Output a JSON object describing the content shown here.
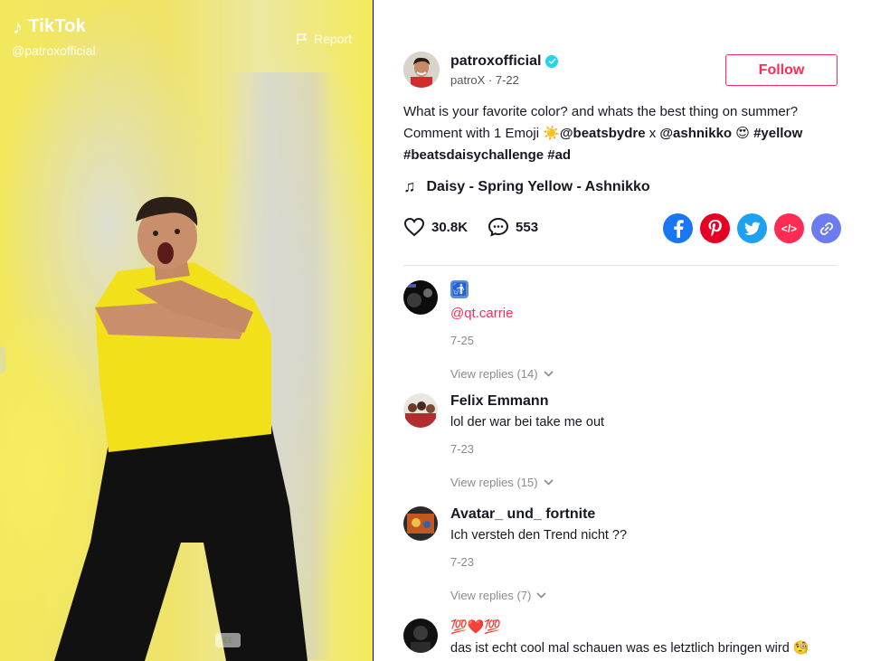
{
  "video": {
    "logo_text": "TikTok",
    "handle": "@patroxofficial",
    "report_label": "Report",
    "watermark": "€€"
  },
  "author": {
    "username": "patroxofficial",
    "subline": "patroX · 7-22",
    "verified": true,
    "follow_label": "Follow"
  },
  "description": {
    "line1": "What is your favorite color? and whats the best thing on summer?",
    "line2_prefix": "Comment with 1 Emoji ",
    "emoji_sun": "☀️",
    "mention1": "@beatsbydre",
    "x_text": " x ",
    "mention2": "@ashnikko",
    "emoji_heart_eyes": " 😍",
    "tag1": "#yellow",
    "tag2": "#beatsdaisychallenge",
    "tag3": "#ad"
  },
  "music": {
    "icon": "music-note-icon",
    "title": "Daisy - Spring Yellow - Ashnikko"
  },
  "stats": {
    "likes": "30.8K",
    "comments": "553"
  },
  "share": [
    {
      "name": "facebook",
      "color": "#1877f2",
      "glyph": "f"
    },
    {
      "name": "pinterest",
      "color": "#e60023",
      "glyph": "P"
    },
    {
      "name": "twitter",
      "color": "#1da1f2",
      "glyph": "t"
    },
    {
      "name": "embed",
      "color": "#fe2c55",
      "glyph": "</>"
    },
    {
      "name": "link",
      "color": "#6c7bf0",
      "glyph": "⛓"
    }
  ],
  "comments": [
    {
      "name": "",
      "emoji": "🚮",
      "mention": "@qt.carrie",
      "date": "7-25",
      "replies": "View replies (14)"
    },
    {
      "name": "Felix Emmann",
      "text": "lol der war bei take me out",
      "date": "7-23",
      "replies": "View replies (15)"
    },
    {
      "name": "Avatar_ und_ fortnite",
      "text": "Ich versteh den Trend nicht ??",
      "date": "7-23",
      "replies": "View replies (7)"
    },
    {
      "name": "💯❤️💯",
      "text": "das ist echt cool mal schauen was es letztlich bringen wird 🧐"
    }
  ]
}
